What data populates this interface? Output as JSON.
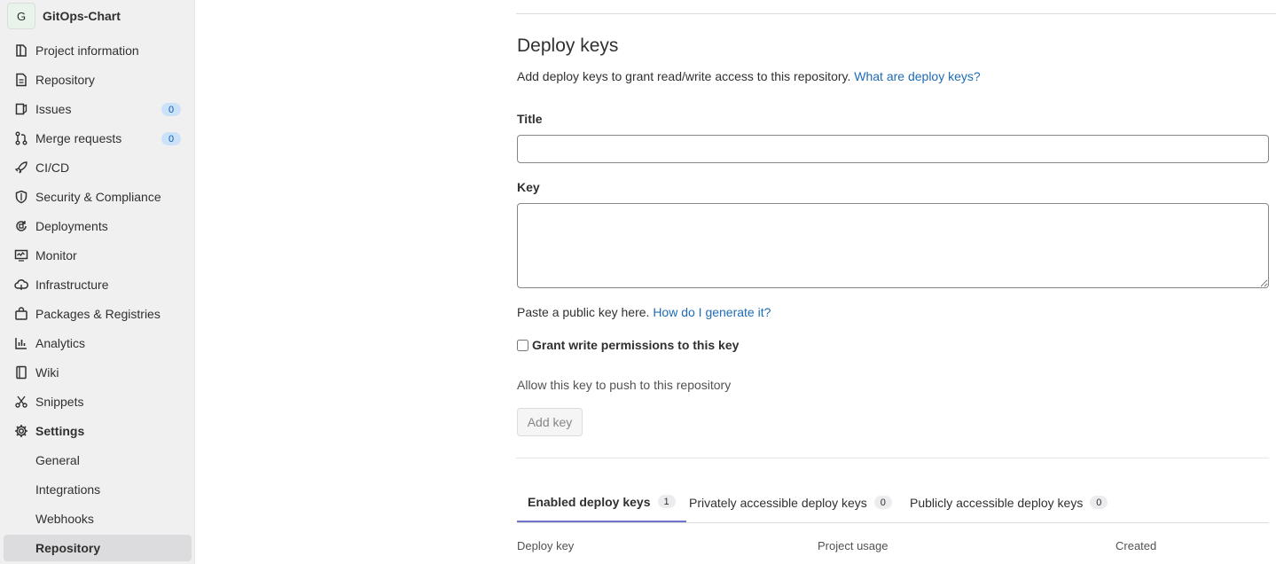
{
  "project": {
    "avatar_letter": "G",
    "name": "GitOps-Chart"
  },
  "nav": [
    {
      "label": "Project information",
      "icon": "project-icon"
    },
    {
      "label": "Repository",
      "icon": "repository-icon"
    },
    {
      "label": "Issues",
      "icon": "issues-icon",
      "badge": "0"
    },
    {
      "label": "Merge requests",
      "icon": "merge-request-icon",
      "badge": "0"
    },
    {
      "label": "CI/CD",
      "icon": "rocket-icon"
    },
    {
      "label": "Security & Compliance",
      "icon": "shield-icon"
    },
    {
      "label": "Deployments",
      "icon": "deployments-icon"
    },
    {
      "label": "Monitor",
      "icon": "monitor-icon"
    },
    {
      "label": "Infrastructure",
      "icon": "cloud-icon"
    },
    {
      "label": "Packages & Registries",
      "icon": "package-icon"
    },
    {
      "label": "Analytics",
      "icon": "chart-icon"
    },
    {
      "label": "Wiki",
      "icon": "book-icon"
    },
    {
      "label": "Snippets",
      "icon": "scissors-icon"
    },
    {
      "label": "Settings",
      "icon": "gear-icon"
    }
  ],
  "settings_sub": [
    {
      "label": "General"
    },
    {
      "label": "Integrations"
    },
    {
      "label": "Webhooks"
    },
    {
      "label": "Repository"
    }
  ],
  "deploy_keys": {
    "title": "Deploy keys",
    "description": "Add deploy keys to grant read/write access to this repository.",
    "description_link": "What are deploy keys?",
    "title_label": "Title",
    "title_value": "",
    "key_label": "Key",
    "key_value": "",
    "help_text": "Paste a public key here.",
    "help_link": "How do I generate it?",
    "grant_label": "Grant write permissions to this key",
    "grant_checked": false,
    "allow_text": "Allow this key to push to this repository",
    "add_button": "Add key"
  },
  "tabs": [
    {
      "label": "Enabled deploy keys",
      "count": "1"
    },
    {
      "label": "Privately accessible deploy keys",
      "count": "0"
    },
    {
      "label": "Publicly accessible deploy keys",
      "count": "0"
    }
  ],
  "table_headers": [
    "Deploy key",
    "Project usage",
    "Created"
  ],
  "colors": {
    "link": "#1f6bb5",
    "active_tab_border": "#6e76c9",
    "badge_bg": "#cbe2f9"
  }
}
